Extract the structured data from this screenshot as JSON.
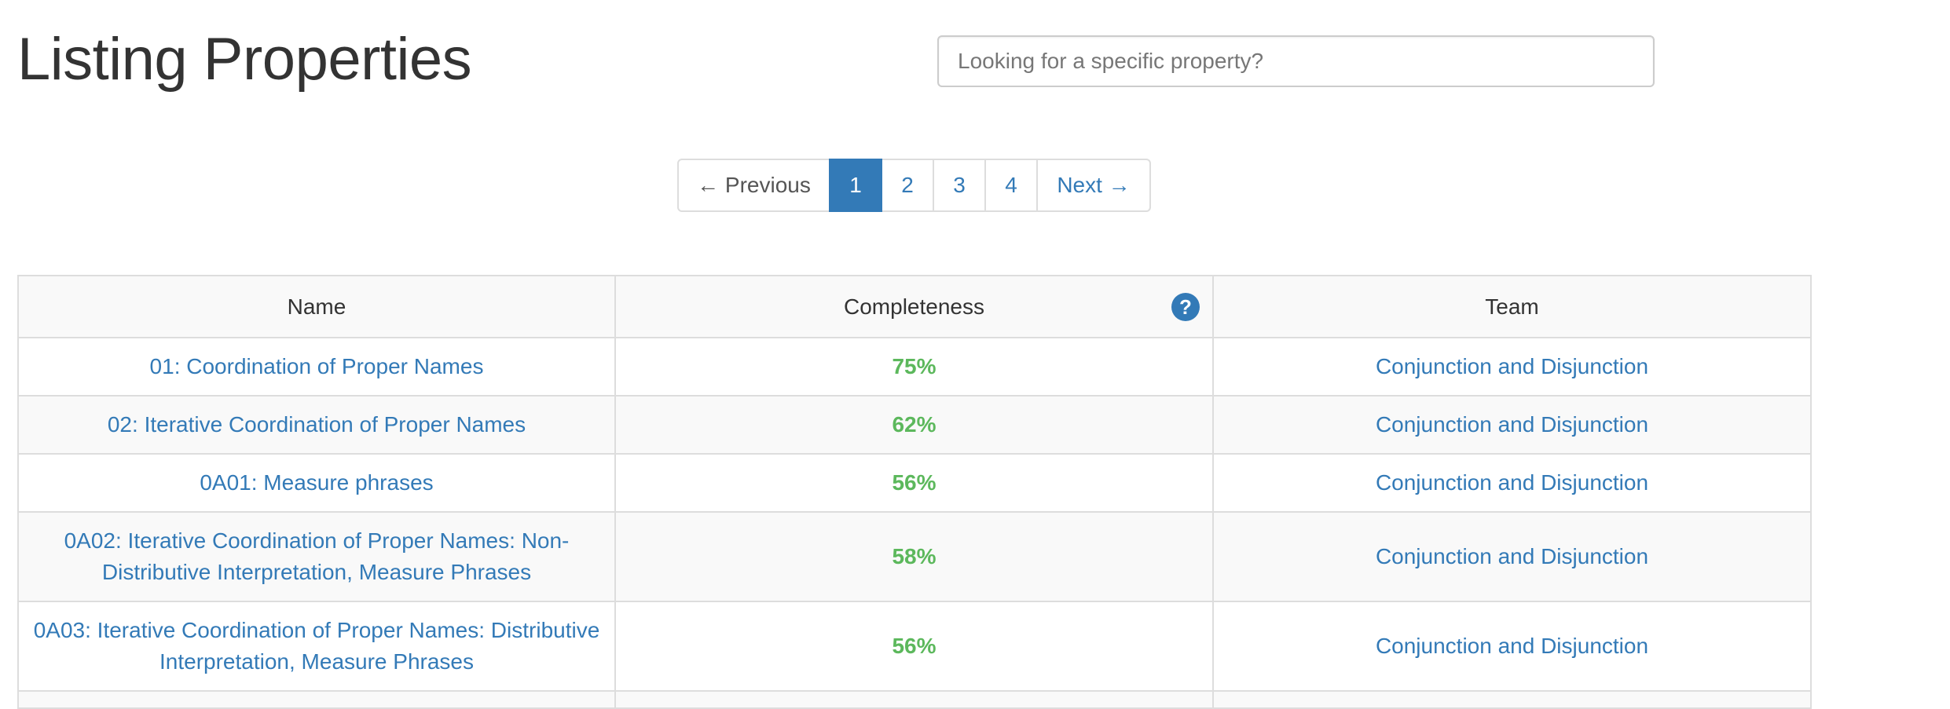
{
  "page": {
    "title": "Listing Properties"
  },
  "search": {
    "placeholder": "Looking for a specific property?",
    "value": ""
  },
  "pagination": {
    "previous_label": "← Previous",
    "next_label": "Next →",
    "pages": [
      "1",
      "2",
      "3",
      "4"
    ],
    "current_page": "1"
  },
  "table": {
    "headers": {
      "name": "Name",
      "completeness": "Completeness",
      "team": "Team"
    },
    "help_icon": "question-circle-icon",
    "help_glyph": "?",
    "rows": [
      {
        "name": "01: Coordination of Proper Names",
        "completeness": "75%",
        "team": "Conjunction and Disjunction"
      },
      {
        "name": "02: Iterative Coordination of Proper Names",
        "completeness": "62%",
        "team": "Conjunction and Disjunction"
      },
      {
        "name": "0A01: Measure phrases",
        "completeness": "56%",
        "team": "Conjunction and Disjunction"
      },
      {
        "name": "0A02: Iterative Coordination of Proper Names: Non-Distributive Interpretation, Measure Phrases",
        "completeness": "58%",
        "team": "Conjunction and Disjunction"
      },
      {
        "name": "0A03: Iterative Coordination of Proper Names: Distributive Interpretation, Measure Phrases",
        "completeness": "56%",
        "team": "Conjunction and Disjunction"
      }
    ]
  },
  "colors": {
    "link": "#337ab7",
    "active_page_bg": "#337ab7",
    "completeness_text": "#5cb85c",
    "border": "#dddddd",
    "stripe": "#f9f9f9"
  }
}
